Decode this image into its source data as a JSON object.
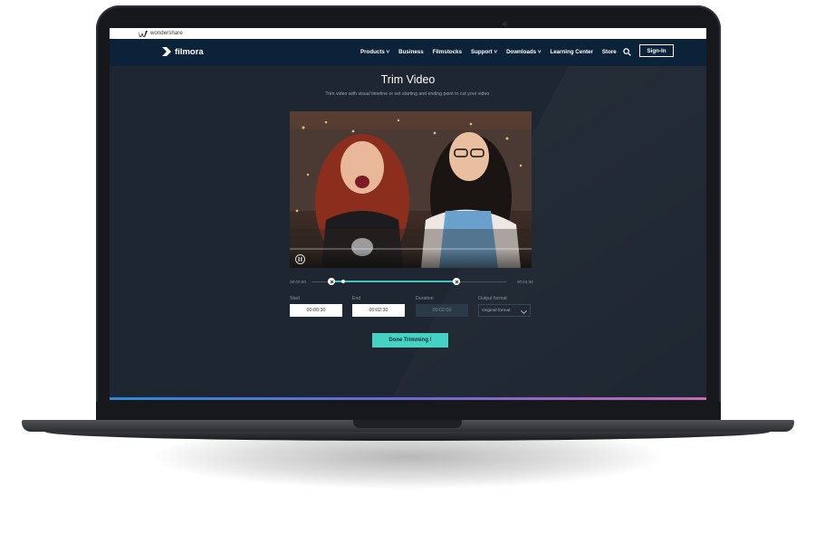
{
  "wonderhsare_bar": {
    "brand": "wondershare"
  },
  "nav": {
    "logo": "filmora",
    "links": [
      "Products",
      "Business",
      "Filmstocks",
      "Support",
      "Downloads",
      "Learning Center",
      "Store"
    ],
    "signin": "Sign-In"
  },
  "page": {
    "title": "Trim Video",
    "subtitle": "Trim video with visual timeline or set starting and ending point to cut your video."
  },
  "timeline": {
    "start_time": "00:00:00",
    "end_time": "00:04:30",
    "range_start_fraction": 0.1,
    "range_end_fraction": 0.74
  },
  "fields": {
    "start_label": "Start",
    "start_value": "00:00:30",
    "end_label": "End",
    "end_value": "00:02:30",
    "duration_label": "Duration",
    "duration_value": "00:02:00",
    "format_label": "Output format",
    "format_value": "Original format"
  },
  "actions": {
    "done": "Done Trimming !"
  },
  "colors": {
    "accent": "#46d2c2",
    "nav_bg": "#0c2238",
    "screen_bg": "#1e2631"
  }
}
